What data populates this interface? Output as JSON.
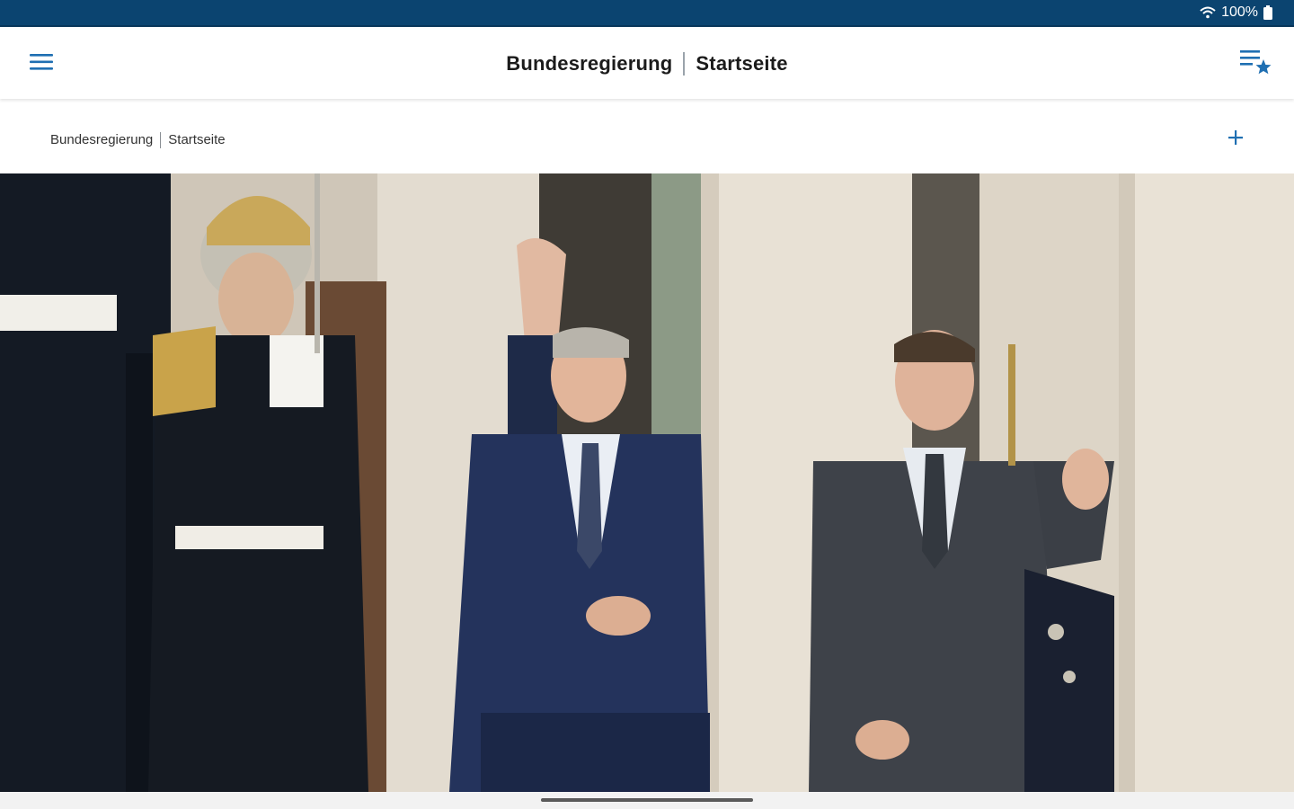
{
  "status_bar": {
    "battery_text": "100%",
    "icons": [
      "wifi-icon",
      "battery-icon"
    ]
  },
  "app_bar": {
    "title_left": "Bundesregierung",
    "title_right": "Startseite",
    "menu_icon": "hamburger-menu-icon",
    "action_icon": "playlist-star-icon"
  },
  "breadcrumb": {
    "left": "Bundesregierung",
    "right": "Startseite",
    "action_icon": "plus-icon"
  },
  "colors": {
    "status_bar": "#0b4470",
    "accent": "#1f6fb2",
    "title_text": "#1b1b1b"
  }
}
